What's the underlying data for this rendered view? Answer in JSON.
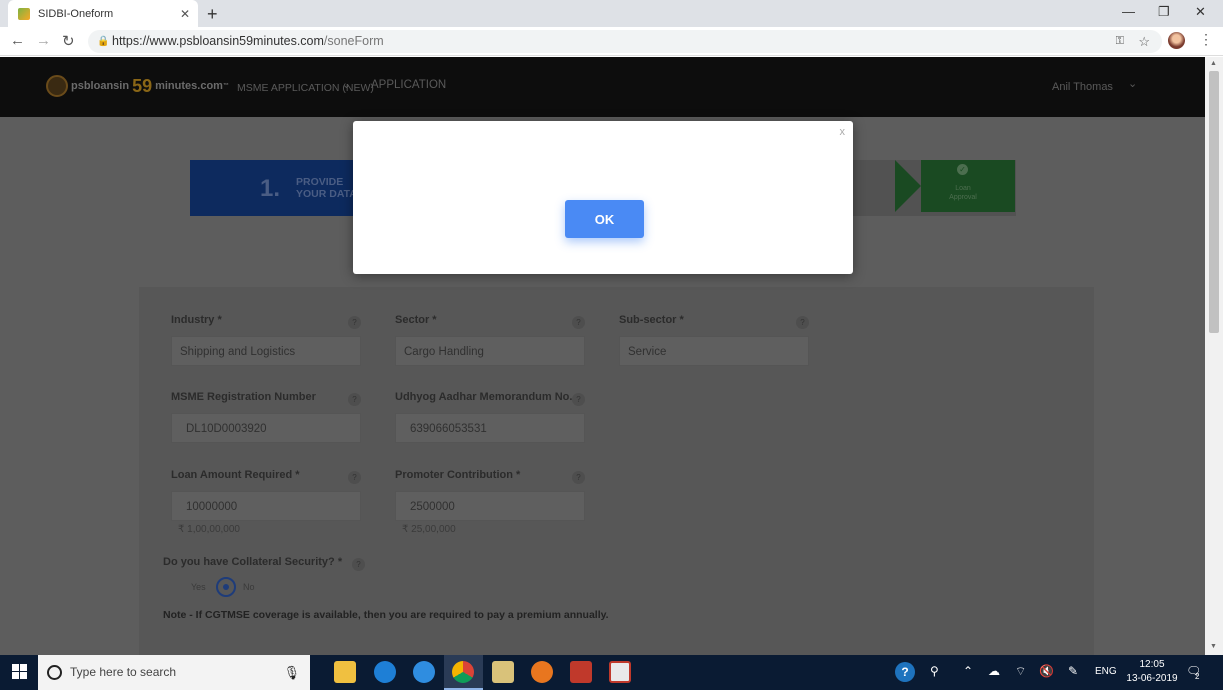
{
  "browser": {
    "tab_title": "SIDBI-Oneform",
    "tab_close": "✕",
    "new_tab": "+",
    "url_domain": "https://www.psbloansin59minutes.com",
    "url_path": "/soneForm",
    "win_min": "—",
    "win_restore": "❐",
    "win_close": "✕"
  },
  "site": {
    "logo_text_1": "psbloansin",
    "logo_text_59": "59",
    "logo_text_2": "minutes.com",
    "logo_tm": "™",
    "nav_items": [
      "MSME APPLICATION (NEW)",
      "APPLICATION"
    ],
    "user_name": "Anil Thomas"
  },
  "stepper": {
    "step1_number": "1.",
    "step1_line1": "PROVIDE",
    "step1_line2": "YOUR DATA",
    "last_step_line1": "Loan",
    "last_step_line2": "Approval"
  },
  "form": {
    "industry_label": "Industry *",
    "industry_value": "Shipping and Logistics",
    "sector_label": "Sector *",
    "sector_value": "Cargo Handling",
    "subsector_label": "Sub-sector *",
    "subsector_value": "Service",
    "msme_reg_label": "MSME Registration Number",
    "msme_reg_value": "DL10D0003920",
    "udhyog_label": "Udhyog Aadhar Memorandum No.",
    "udhyog_value": "639066053531",
    "loan_label": "Loan Amount Required *",
    "loan_value": "10000000",
    "loan_formatted": "₹ 1,00,00,000",
    "promoter_label": "Promoter Contribution *",
    "promoter_value": "2500000",
    "promoter_formatted": "₹ 25,00,000",
    "collateral_label": "Do you have Collateral Security? *",
    "radio_yes": "Yes",
    "radio_no": "No",
    "collateral_selected": "No",
    "note": "Note - If CGTMSE coverage is available, then you are required to pay a premium annually.",
    "help_glyph": "?"
  },
  "modal": {
    "close_label": "x",
    "ok_label": "OK"
  },
  "taskbar": {
    "search_placeholder": "Type here to search",
    "lang": "ENG",
    "time": "12:05",
    "date": "13-06-2019",
    "notif_count": "2"
  },
  "colors": {
    "ok_button": "#4a8af4",
    "taskbar": "#0a1b33",
    "overlay_page": "#5d5d5d"
  }
}
